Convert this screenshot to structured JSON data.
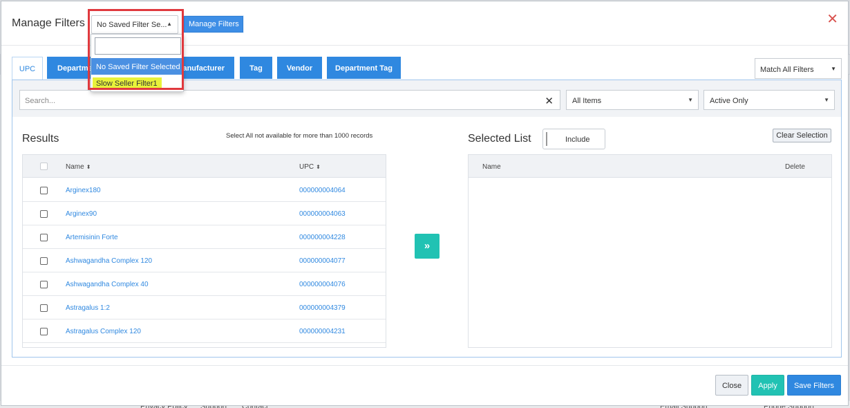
{
  "modal": {
    "title": "Manage Filters",
    "close_icon": "close-icon"
  },
  "saved_filter": {
    "value": "No Saved Filter Se...",
    "manage_label": "Manage Filters",
    "options": [
      "No Saved Filter Selected",
      "Slow Seller Filter1"
    ]
  },
  "tabs": [
    "UPC",
    "Department",
    "Manufacturer",
    "Tag",
    "Vendor",
    "Department Tag"
  ],
  "tabs_visible": {
    "department": "Departme",
    "manufacturer": "anufacturer"
  },
  "match_select": "Match All Filters",
  "search": {
    "placeholder": "Search..."
  },
  "items_select": "All Items",
  "active_select": "Active Only",
  "results": {
    "title": "Results",
    "note": "Select All not available for more than 1000 records",
    "columns": [
      "Name",
      "UPC"
    ],
    "rows": [
      {
        "name": "Arginex180",
        "upc": "000000004064"
      },
      {
        "name": "Arginex90",
        "upc": "000000004063"
      },
      {
        "name": "Artemisinin Forte",
        "upc": "000000004228"
      },
      {
        "name": "Ashwagandha Complex 120",
        "upc": "000000004077"
      },
      {
        "name": "Ashwagandha Complex 40",
        "upc": "000000004076"
      },
      {
        "name": "Astragalus 1:2",
        "upc": "000000004379"
      },
      {
        "name": "Astragalus Complex 120",
        "upc": "000000004231"
      }
    ]
  },
  "selected": {
    "title": "Selected List",
    "include_label": "Include",
    "clear_label": "Clear Selection",
    "columns": [
      "Name",
      "Delete"
    ]
  },
  "footer": {
    "close": "Close",
    "apply": "Apply",
    "save": "Save Filters"
  },
  "background_footer": [
    "Privacy Policy",
    "Support",
    "Contact",
    "Email Support",
    "Phone Support"
  ],
  "colors": {
    "primary": "#2f88e0",
    "teal": "#21c2b3",
    "danger": "#e0393e",
    "highlight": "#e8f23a"
  }
}
